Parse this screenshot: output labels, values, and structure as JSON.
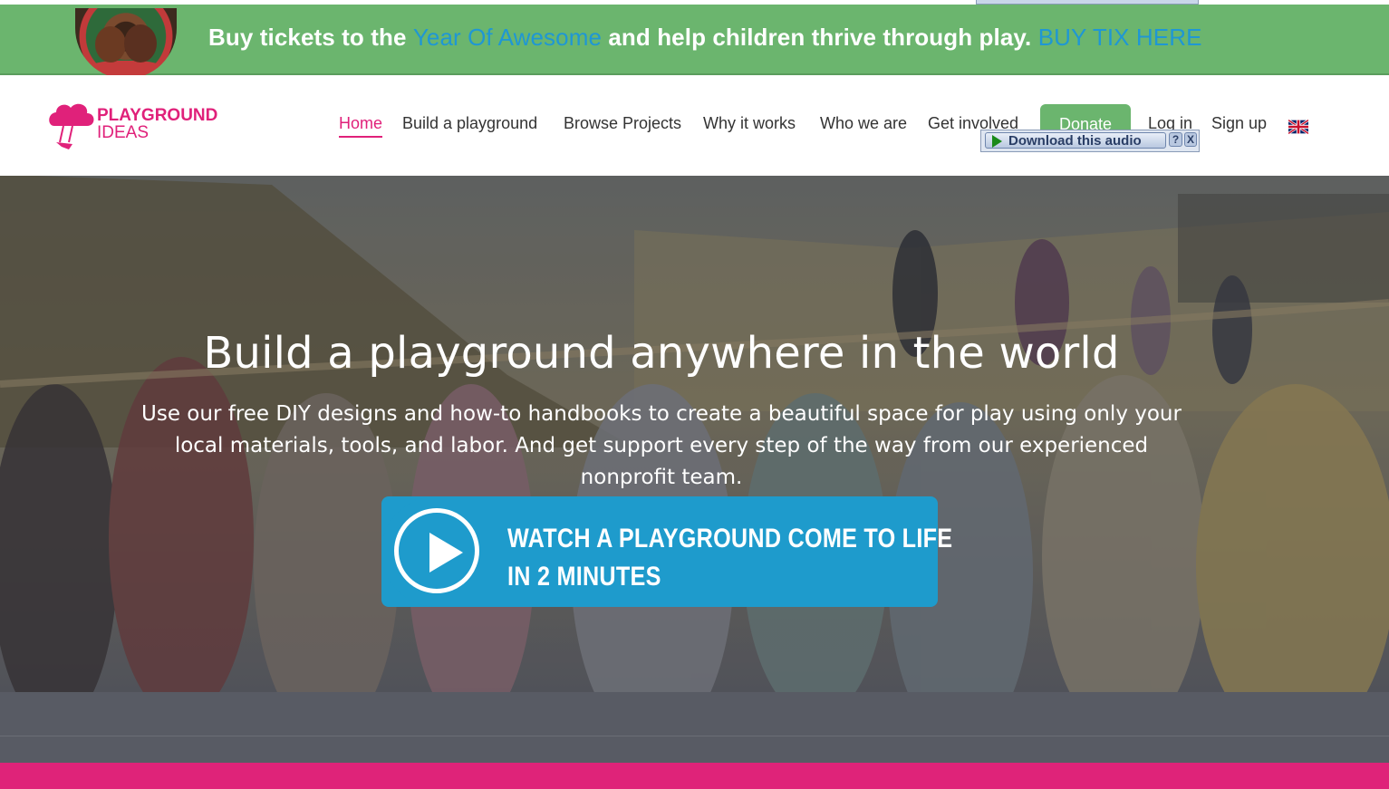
{
  "promo": {
    "text_before": "Buy tickets to the ",
    "link_text": "Year Of Awesome",
    "text_after": " and help children thrive through play. ",
    "cta_text": "BUY TIX HERE"
  },
  "logo": {
    "line1": "PLAYGROUND",
    "line2": "IDEAS"
  },
  "nav": {
    "items": [
      {
        "label": "Home"
      },
      {
        "label": "Build a playground"
      },
      {
        "label": "Browse Projects"
      },
      {
        "label": "Why it works"
      },
      {
        "label": "Who we are"
      },
      {
        "label": "Get involved"
      },
      {
        "label": "Log in"
      },
      {
        "label": "Sign up"
      }
    ],
    "donate_label": "Donate",
    "language_icon": "uk-flag-icon"
  },
  "audio_widget": {
    "button_label": "Download this audio",
    "help_label": "?",
    "close_label": "X"
  },
  "hero": {
    "title": "Build a playground anywhere in the world",
    "subtitle": "Use our free DIY designs and how-to handbooks to create a beautiful space for play using only your local materials, tools, and labor. And get support every step of the way from our experienced nonprofit team.",
    "video_cta_line1": "WATCH A PLAYGROUND COME TO LIFE",
    "video_cta_line2": "IN 2 MINUTES"
  },
  "colors": {
    "promo_green": "#6bb56e",
    "brand_pink": "#e0217a",
    "link_blue": "#1f97d4",
    "video_blue": "#1e9bcc",
    "footer_gray": "#585b64"
  }
}
